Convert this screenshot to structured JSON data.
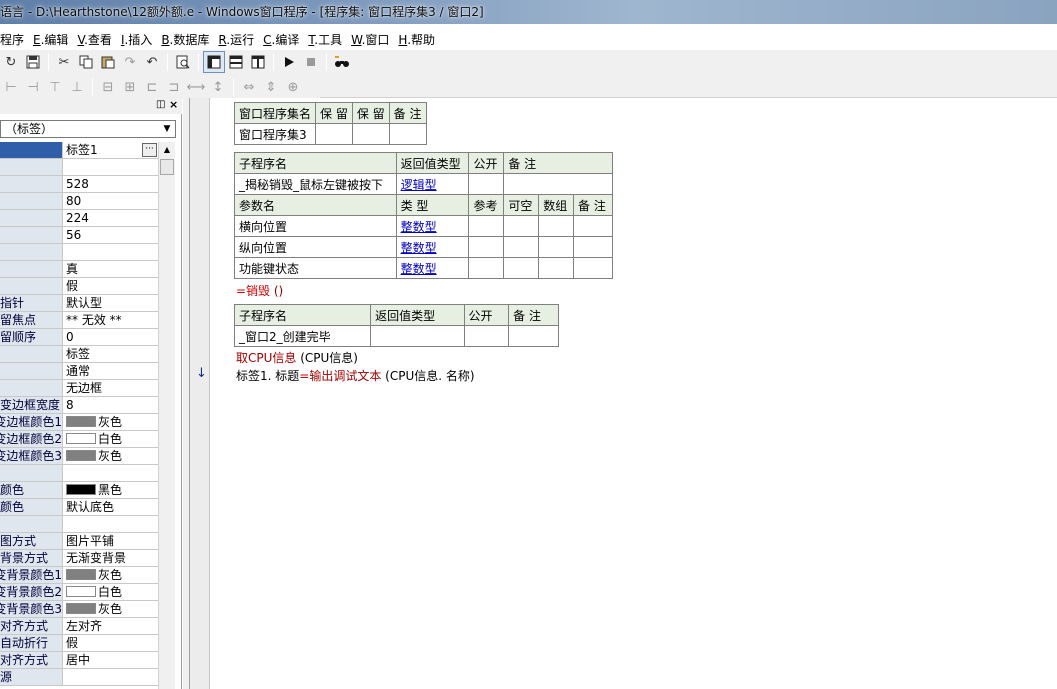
{
  "window": {
    "title": "语言 - D:\\Hearthstone\\12额外额.e - Windows窗口程序 - [程序集: 窗口程序集3 / 窗口2]"
  },
  "menu": [
    {
      "key": "",
      "label": "程序"
    },
    {
      "key": "E",
      "label": ".编辑"
    },
    {
      "key": "V",
      "label": ".查看"
    },
    {
      "key": "I",
      "label": ".插入"
    },
    {
      "key": "B",
      "label": ".数据库"
    },
    {
      "key": "R",
      "label": ".运行"
    },
    {
      "key": "C",
      "label": ".编译"
    },
    {
      "key": "T",
      "label": ".工具"
    },
    {
      "key": "W",
      "label": ".窗口"
    },
    {
      "key": "H",
      "label": ".帮助"
    }
  ],
  "property_panel": {
    "combo_value": "（标签）",
    "rows": [
      {
        "name": "",
        "value": "标签1",
        "ellipsis": true,
        "selected": true
      },
      {
        "name": "",
        "value": ""
      },
      {
        "name": "",
        "value": "528"
      },
      {
        "name": "",
        "value": "80"
      },
      {
        "name": "",
        "value": "224"
      },
      {
        "name": "",
        "value": "56"
      },
      {
        "name": "",
        "value": ""
      },
      {
        "name": "",
        "value": "真"
      },
      {
        "name": "",
        "value": "假"
      },
      {
        "name": "指针",
        "value": "默认型"
      },
      {
        "name": "留焦点",
        "value": "** 无效 **"
      },
      {
        "name": "留顺序",
        "value": "0"
      },
      {
        "name": "",
        "value": "标签"
      },
      {
        "name": "",
        "value": "通常"
      },
      {
        "name": "",
        "value": "无边框"
      },
      {
        "name": "变边框宽度",
        "value": "8"
      },
      {
        "name": "变边框颜色1",
        "value": "灰色",
        "swatch": "#808080"
      },
      {
        "name": "变边框颜色2",
        "value": "白色",
        "swatch": "#ffffff"
      },
      {
        "name": "变边框颜色3",
        "value": "灰色",
        "swatch": "#808080"
      },
      {
        "name": "",
        "value": ""
      },
      {
        "name": "颜色",
        "value": "黑色",
        "swatch": "#000000"
      },
      {
        "name": "颜色",
        "value": "默认底色"
      },
      {
        "name": "",
        "value": ""
      },
      {
        "name": "图方式",
        "value": "图片平铺"
      },
      {
        "name": "背景方式",
        "value": "无渐变背景"
      },
      {
        "name": "变背景颜色1",
        "value": "灰色",
        "swatch": "#808080"
      },
      {
        "name": "变背景颜色2",
        "value": "白色",
        "swatch": "#ffffff"
      },
      {
        "name": "变背景颜色3",
        "value": "灰色",
        "swatch": "#808080"
      },
      {
        "name": "对齐方式",
        "value": "左对齐"
      },
      {
        "name": "自动折行",
        "value": "假"
      },
      {
        "name": "对齐方式",
        "value": "居中"
      },
      {
        "name": "源",
        "value": ""
      }
    ]
  },
  "code": {
    "assembly_table": {
      "headers": [
        "窗口程序集名",
        "保 留",
        "保 留",
        "备 注"
      ],
      "row": [
        "窗口程序集3",
        "",
        "",
        ""
      ]
    },
    "sub1_table": {
      "headers": [
        "子程序名",
        "返回值类型",
        "公开",
        "备 注"
      ],
      "row": [
        "_揭秘销毁_鼠标左键被按下",
        "逻辑型",
        "",
        ""
      ],
      "param_headers": [
        "参数名",
        "类 型",
        "参考",
        "可空",
        "数组",
        "备 注"
      ],
      "params": [
        [
          "横向位置",
          "整数型",
          "",
          "",
          "",
          ""
        ],
        [
          "纵向位置",
          "整数型",
          "",
          "",
          "",
          ""
        ],
        [
          "功能键状态",
          "整数型",
          "",
          "",
          "",
          ""
        ]
      ]
    },
    "line_destroy_kw": "=销毁",
    "line_destroy_args": " ()",
    "sub2_table": {
      "headers": [
        "子程序名",
        "返回值类型",
        "公开",
        "备 注"
      ],
      "row": [
        "_窗口2_创建完毕",
        "",
        "",
        ""
      ]
    },
    "line_cpu_fn": "取CPU信息",
    "line_cpu_args": " (CPU信息)",
    "line_label_a": "标签1. 标题",
    "line_label_eq": "=",
    "line_label_fn": "输出调试文本",
    "line_label_args": " (CPU信息. 名称)",
    "gutter_arrow": "↓"
  }
}
